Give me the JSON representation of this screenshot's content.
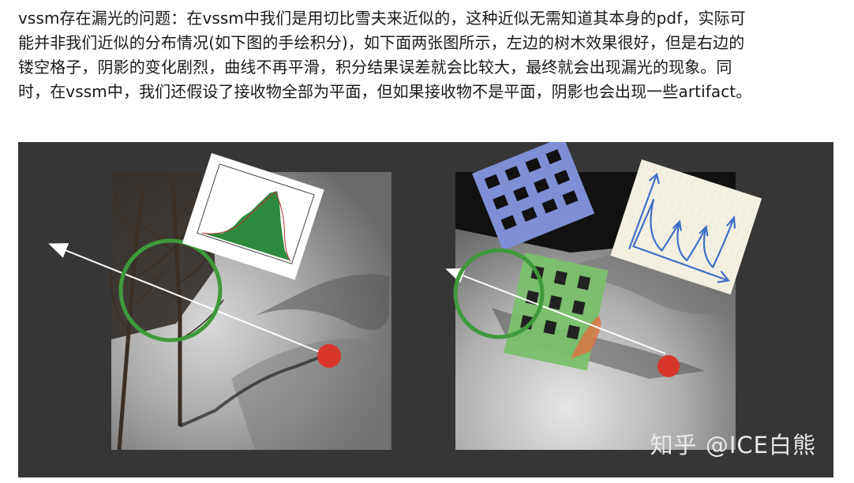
{
  "paragraph": {
    "lines": [
      "vssm存在漏光的问题：在vssm中我们是用切比雪夫来近似的，这种近似无需知道其本身的pdf，实际可",
      "能并非我们近似的分布情况(如下图的手绘积分)，如下面两张图所示，左边的树木效果很好，但是右边的",
      "镂空格子，阴影的变化剧烈，曲线不再平滑，积分结果误差就会比较大，最终就会出现漏光的现象。同",
      "时，在vssm中，我们还假设了接收物全部为平面，但如果接收物不是平面，阴影也会出现一些artifact。"
    ]
  },
  "figure": {
    "watermark": "知乎 @ICE白熊",
    "colors": {
      "background": "#363636",
      "circle": "#3e9a3a",
      "light": "#d8362a",
      "grid_blue": "#7e8fd6",
      "grid_green": "#79c06a",
      "histogram": "#2e8a3e"
    }
  }
}
